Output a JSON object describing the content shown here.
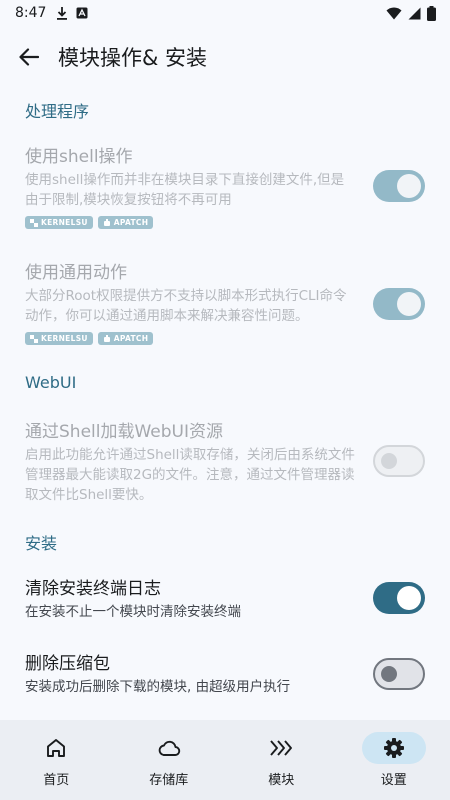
{
  "status_bar": {
    "time": "8:47"
  },
  "top_bar": {
    "title": "模块操作& 安装"
  },
  "sections": {
    "handler": {
      "title": "处理程序"
    },
    "webui": {
      "title": "WebUI"
    },
    "install": {
      "title": "安装"
    }
  },
  "prefs": {
    "shell_ops": {
      "title": "使用shell操作",
      "summary": "使用shell操作而并非在模块目录下直接创建文件,但是由于限制,模块恢复按钮将不再可用",
      "badges": [
        "KERNELSU",
        "APATCH"
      ],
      "checked": true,
      "enabled": false
    },
    "generic_action": {
      "title": "使用通用动作",
      "summary": "大部分Root权限提供方不支持以脚本形式执行CLI命令动作，你可以通过通用脚本来解决兼容性问题。",
      "badges": [
        "KERNELSU",
        "APATCH"
      ],
      "checked": true,
      "enabled": false
    },
    "shell_webui": {
      "title": "通过Shell加载WebUI资源",
      "summary": "启用此功能允许通过Shell读取存储，关闭后由系统文件管理器最大能读取2G的文件。注意，通过文件管理器读取文件比Shell要快。",
      "checked": false,
      "enabled": false
    },
    "clear_log": {
      "title": "清除安装终端日志",
      "summary": "在安装不止一个模块时清除安装终端",
      "checked": true,
      "enabled": true
    },
    "delete_zip": {
      "title": "删除压缩包",
      "summary": "安装成功后删除下载的模块, 由超级用户执行",
      "checked": false,
      "enabled": true
    }
  },
  "bottom_nav": {
    "items": [
      {
        "label": "首页",
        "icon": "home-icon"
      },
      {
        "label": "存储库",
        "icon": "cloud-icon"
      },
      {
        "label": "模块",
        "icon": "modules-icon"
      },
      {
        "label": "设置",
        "icon": "settings-icon"
      }
    ],
    "active_index": 3
  },
  "colors": {
    "accent": "#2f6c86",
    "background": "#f7f9fd",
    "nav_background": "#ebeef3",
    "nav_active_pill": "#cde5f3",
    "badge": "#9fc1ce"
  }
}
